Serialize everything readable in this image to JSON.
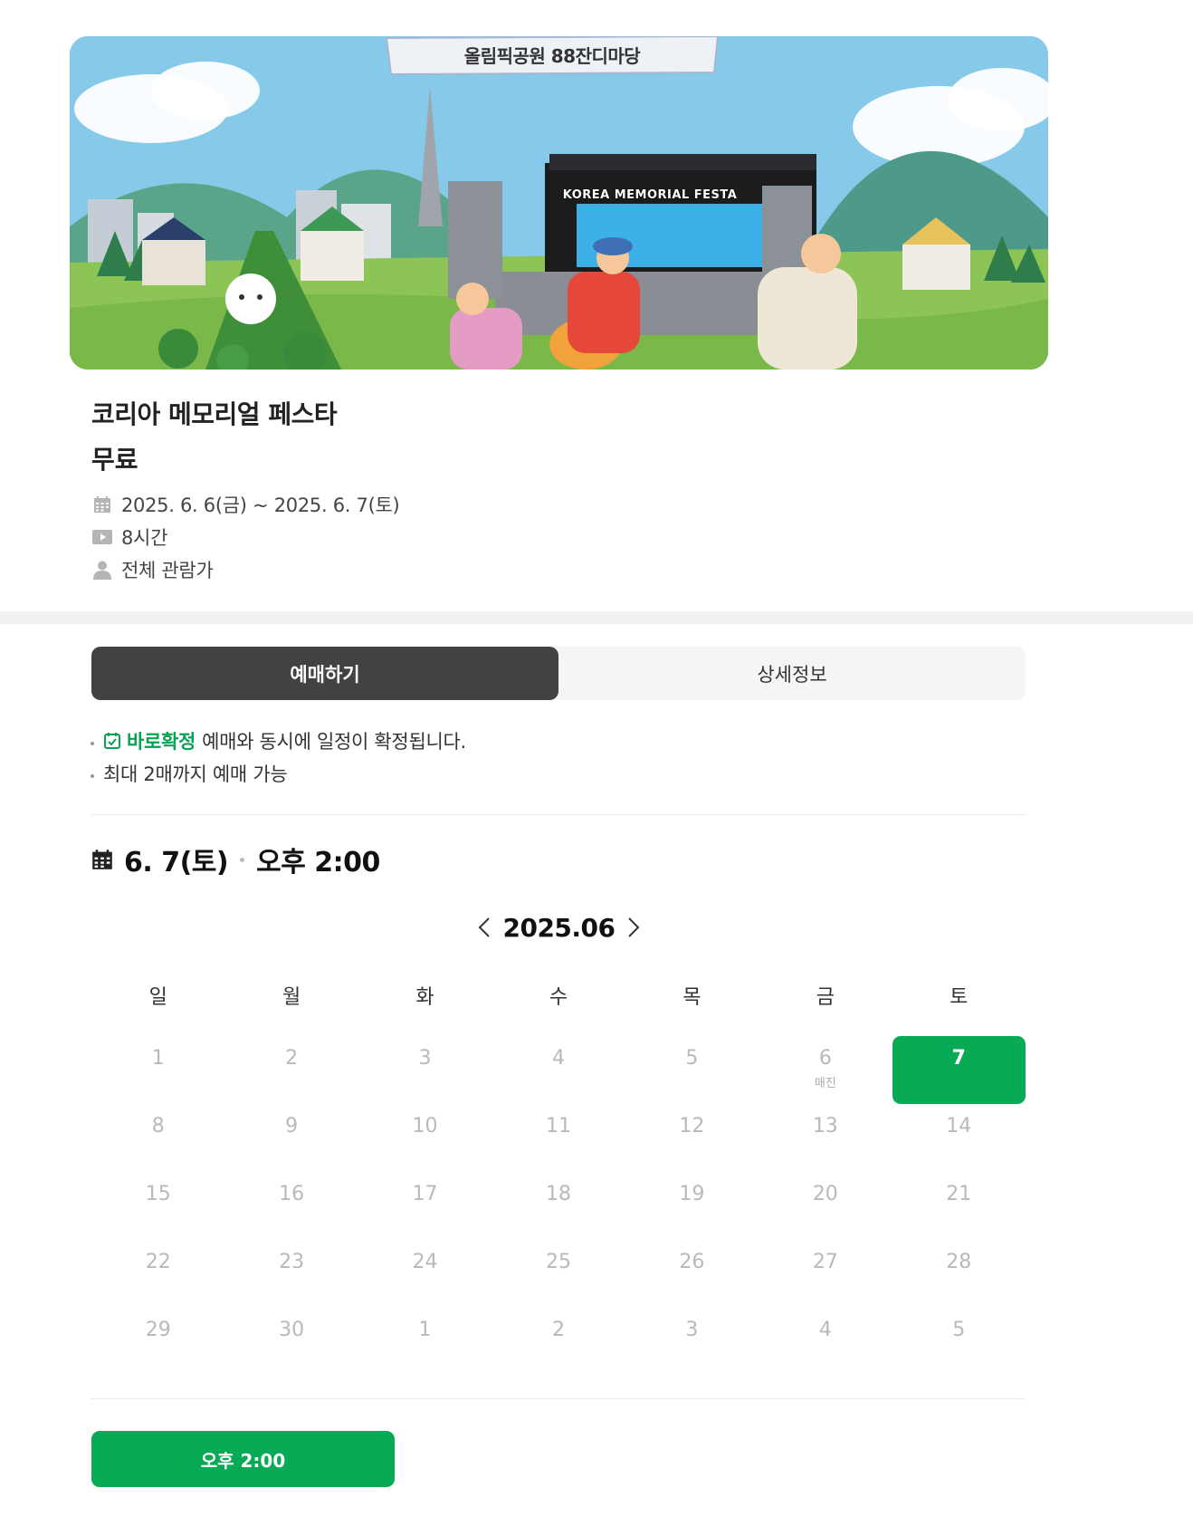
{
  "banner": {
    "venue_label": "올림픽공원 88잔디마당",
    "stage_title": "KOREA MEMORIAL FESTA"
  },
  "event": {
    "title": "코리아 메모리얼 페스타",
    "price": "무료",
    "date_range": "2025. 6. 6(금) ~ 2025. 6. 7(토)",
    "duration": "8시간",
    "age_rating": "전체 관람가"
  },
  "tabs": [
    {
      "label": "예매하기",
      "active": true
    },
    {
      "label": "상세정보",
      "active": false
    }
  ],
  "notices": {
    "confirm_badge": "바로확정",
    "confirm_text": "예매와 동시에 일정이 확정됩니다.",
    "limit_text": "최대 2매까지 예매 가능"
  },
  "selection": {
    "date": "6. 7(토)",
    "time": "오후 2:00"
  },
  "calendar": {
    "month_label": "2025.06",
    "weekdays": [
      "일",
      "월",
      "화",
      "수",
      "목",
      "금",
      "토"
    ],
    "weeks": [
      [
        {
          "d": "1"
        },
        {
          "d": "2"
        },
        {
          "d": "3"
        },
        {
          "d": "4"
        },
        {
          "d": "5"
        },
        {
          "d": "6",
          "sub": "매진"
        },
        {
          "d": "7",
          "selected": true
        }
      ],
      [
        {
          "d": "8"
        },
        {
          "d": "9"
        },
        {
          "d": "10"
        },
        {
          "d": "11"
        },
        {
          "d": "12"
        },
        {
          "d": "13"
        },
        {
          "d": "14"
        }
      ],
      [
        {
          "d": "15"
        },
        {
          "d": "16"
        },
        {
          "d": "17"
        },
        {
          "d": "18"
        },
        {
          "d": "19"
        },
        {
          "d": "20"
        },
        {
          "d": "21"
        }
      ],
      [
        {
          "d": "22"
        },
        {
          "d": "23"
        },
        {
          "d": "24"
        },
        {
          "d": "25"
        },
        {
          "d": "26"
        },
        {
          "d": "27"
        },
        {
          "d": "28"
        }
      ],
      [
        {
          "d": "29"
        },
        {
          "d": "30"
        },
        {
          "d": "1"
        },
        {
          "d": "2"
        },
        {
          "d": "3"
        },
        {
          "d": "4"
        },
        {
          "d": "5"
        }
      ]
    ]
  },
  "time_slots": [
    {
      "label": "오후 2:00",
      "selected": true
    }
  ],
  "colors": {
    "accent_green": "#09aa56",
    "tab_active_bg": "#424245"
  },
  "icons": {
    "date": "calendar-icon",
    "duration": "play-icon",
    "age": "person-icon",
    "confirm": "check-calendar-icon",
    "prev_month": "chevron-left-icon",
    "next_month": "chevron-right-icon"
  }
}
